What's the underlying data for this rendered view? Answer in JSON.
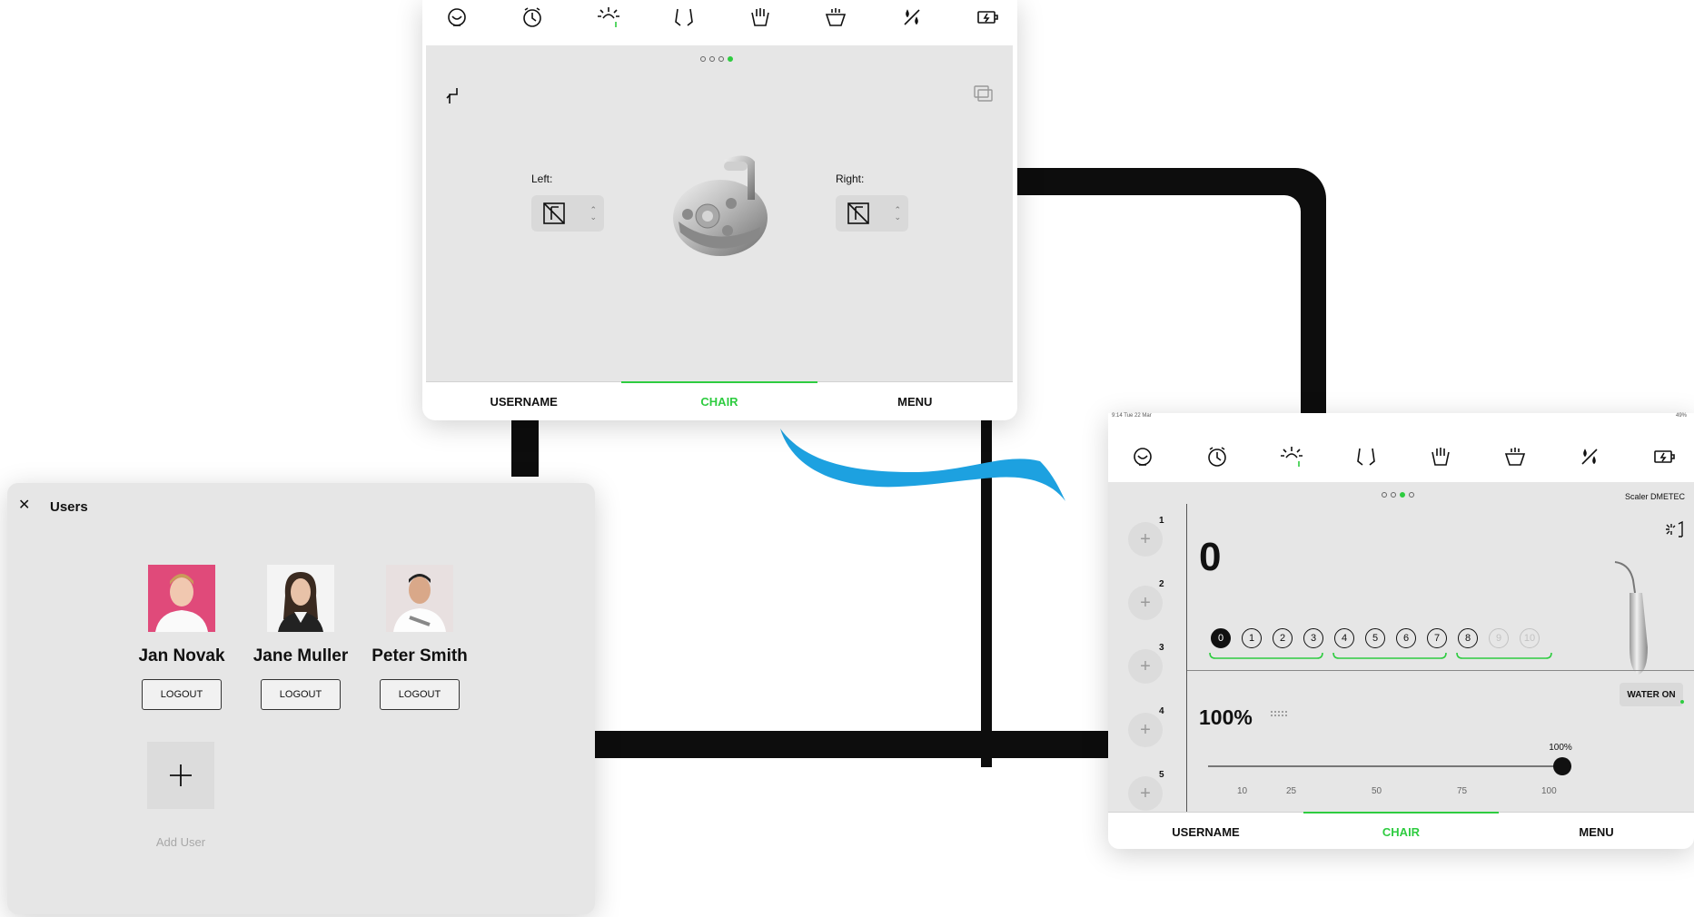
{
  "chair_panel": {
    "pagination_active": 3,
    "left_label": "Left:",
    "right_label": "Right:",
    "tabs": [
      "USERNAME",
      "CHAIR",
      "MENU"
    ],
    "active_tab": "CHAIR"
  },
  "users_panel": {
    "title": "Users",
    "users": [
      {
        "name": "Jan Novak",
        "logout": "LOGOUT",
        "photo_bg": "#e04a7a"
      },
      {
        "name": "Jane Muller",
        "logout": "LOGOUT",
        "photo_bg": "#f4f4f4"
      },
      {
        "name": "Peter Smith",
        "logout": "LOGOUT",
        "photo_bg": "#e8e0e0"
      }
    ],
    "add_user_label": "Add User"
  },
  "scaler_panel": {
    "status_time": "9:14",
    "status_date": "Tue 22 Mar",
    "status_battery": "49%",
    "instrument_name": "Scaler DMETEC",
    "pagination_active": 2,
    "power_value": "0",
    "power_levels": [
      "0",
      "1",
      "2",
      "3",
      "4",
      "5",
      "6",
      "7",
      "8",
      "9",
      "10"
    ],
    "power_selected": 0,
    "water_button": "WATER ON",
    "water_percent": "100%",
    "slider_value": 100,
    "slider_value_label": "100%",
    "slider_ticks": [
      "10",
      "25",
      "50",
      "75",
      "100"
    ],
    "memory_slots": [
      "1",
      "2",
      "3",
      "4",
      "5"
    ],
    "tabs": [
      "USERNAME",
      "CHAIR",
      "MENU"
    ],
    "active_tab": "CHAIR"
  },
  "colors": {
    "accent": "#2ecc40",
    "panel_bg": "#e6e6e6",
    "brand_wave": "#1da1e0"
  }
}
